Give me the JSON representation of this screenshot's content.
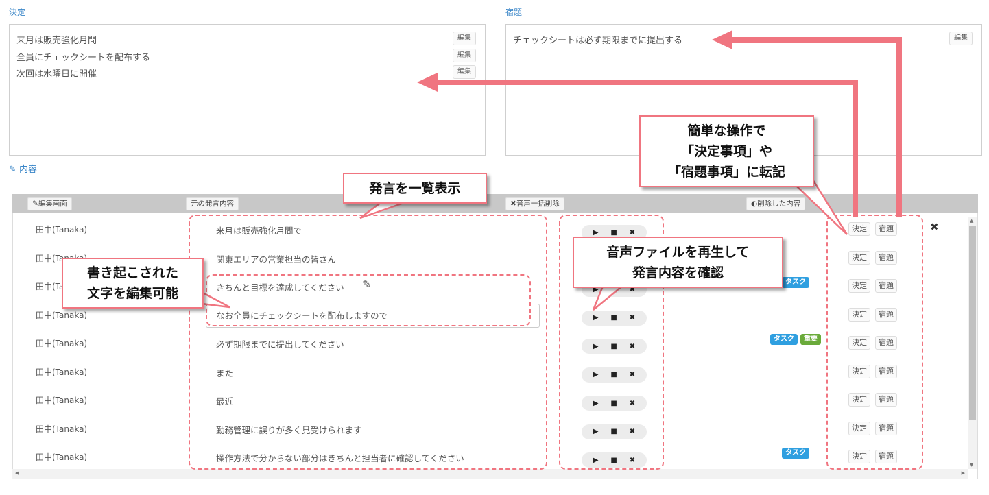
{
  "decisions": {
    "label": "決定",
    "items": [
      "来月は販売強化月間",
      "全員にチェックシートを配布する",
      "次回は水曜日に開催"
    ],
    "edit_label": "編集"
  },
  "homework": {
    "label": "宿題",
    "items": [
      "チェックシートは必ず期限までに提出する"
    ],
    "edit_label": "編集"
  },
  "content": {
    "label": "内容",
    "icon": "edit-icon"
  },
  "table_header": {
    "edit_screen": "編集画面",
    "original": "元の発言内容",
    "bulk_delete": "音声一括削除",
    "deleted": "削除した内容"
  },
  "rows": [
    {
      "speaker": "田中(Tanaka)",
      "text": "来月は販売強化月間で",
      "tags": []
    },
    {
      "speaker": "田中(Tanaka)",
      "text": "関東エリアの営業担当の皆さん",
      "tags": []
    },
    {
      "speaker": "田中(Tanaka)",
      "text": "きちんと目標を達成してください",
      "tags": [
        "タスク"
      ],
      "editing_icon": "pencil-icon"
    },
    {
      "speaker": "田中(Tanaka)",
      "text": "なお全員にチェックシートを配布しますので",
      "tags": [],
      "is_input": true
    },
    {
      "speaker": "田中(Tanaka)",
      "text": "必ず期限までに提出してください",
      "tags": [
        "タスク",
        "重要"
      ]
    },
    {
      "speaker": "田中(Tanaka)",
      "text": "また",
      "tags": []
    },
    {
      "speaker": "田中(Tanaka)",
      "text": "最近",
      "tags": []
    },
    {
      "speaker": "田中(Tanaka)",
      "text": "勤務管理に誤りが多く見受けられます",
      "tags": []
    },
    {
      "speaker": "田中(Tanaka)",
      "text": "操作方法で分からない部分はきちんと担当者に確認してください",
      "tags": [
        "タスク"
      ]
    }
  ],
  "row_buttons": {
    "decision": "決定",
    "homework": "宿題"
  },
  "tag_colors": {
    "タスク": "#2f9fe0",
    "重要": "#6aaa3a"
  },
  "callouts": {
    "list": "発言を一覧表示",
    "edit": [
      "書き起こされた",
      "文字を編集可能"
    ],
    "audio": [
      "音声ファイルを再生して",
      "発言内容を確認"
    ],
    "transfer": [
      "簡単な操作で",
      "「決定事項」や",
      "「宿題事項」に転記"
    ]
  },
  "accent": "#f07580"
}
